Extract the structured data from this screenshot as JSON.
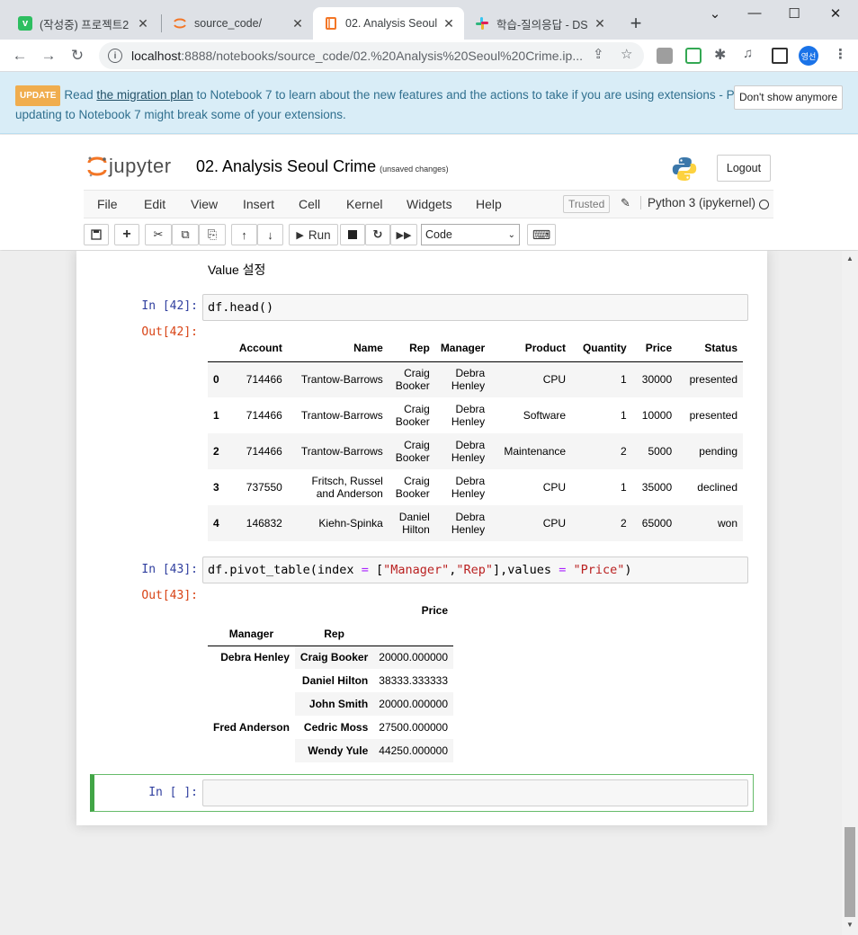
{
  "browser": {
    "tabs": [
      {
        "title": "(작성중) 프로젝트2",
        "favicon": "v",
        "favicon_color": "#2dbe60"
      },
      {
        "title": "source_code/",
        "favicon": "jupyter",
        "favicon_color": "#f37626"
      },
      {
        "title": "02. Analysis Seoul",
        "favicon": "notebook",
        "favicon_color": "#f37626",
        "active": true
      },
      {
        "title": "학습-질의응답 - DS",
        "favicon": "slack",
        "favicon_color": "#e01e5a"
      }
    ],
    "new_tab": "+",
    "window_controls": {
      "minimize": "—",
      "maximize": "☐",
      "close": "✕",
      "tabsearch": "⌄"
    },
    "url_host": "localhost",
    "url_path": ":8888/notebooks/source_code/02.%20Analysis%20Seoul%20Crime.ip...",
    "profile_label": "영선"
  },
  "banner": {
    "badge": "UPDATE",
    "text_before": "Read ",
    "link": "the migration plan",
    "text_after": " to Notebook 7 to learn about the new features and the actions to take if you are using extensions - Please note that updating to Notebook 7 might break some of your extensions.",
    "dismiss": "Don't show anymore"
  },
  "header": {
    "logo_text": "jupyter",
    "notebook_name": "02. Analysis Seoul Crime",
    "unsaved": "(unsaved changes)",
    "logout": "Logout"
  },
  "menu": {
    "items": [
      "File",
      "Edit",
      "View",
      "Insert",
      "Cell",
      "Kernel",
      "Widgets",
      "Help"
    ],
    "trusted": "Trusted",
    "kernel": "Python 3 (ipykernel)"
  },
  "toolbar": {
    "run": "Run",
    "cell_type": "Code"
  },
  "notebook": {
    "markdown_text": "Value 설정",
    "cell42": {
      "in_prompt": "In [42]:",
      "out_prompt": "Out[42]:",
      "code": "df.head()",
      "columns": [
        "",
        "Account",
        "Name",
        "Rep",
        "Manager",
        "Product",
        "Quantity",
        "Price",
        "Status"
      ],
      "rows": [
        {
          "idx": "0",
          "account": "714466",
          "name": "Trantow-Barrows",
          "rep": "Craig Booker",
          "manager": "Debra Henley",
          "product": "CPU",
          "quantity": "1",
          "price": "30000",
          "status": "presented"
        },
        {
          "idx": "1",
          "account": "714466",
          "name": "Trantow-Barrows",
          "rep": "Craig Booker",
          "manager": "Debra Henley",
          "product": "Software",
          "quantity": "1",
          "price": "10000",
          "status": "presented"
        },
        {
          "idx": "2",
          "account": "714466",
          "name": "Trantow-Barrows",
          "rep": "Craig Booker",
          "manager": "Debra Henley",
          "product": "Maintenance",
          "quantity": "2",
          "price": "5000",
          "status": "pending"
        },
        {
          "idx": "3",
          "account": "737550",
          "name": "Fritsch, Russel and Anderson",
          "rep": "Craig Booker",
          "manager": "Debra Henley",
          "product": "CPU",
          "quantity": "1",
          "price": "35000",
          "status": "declined"
        },
        {
          "idx": "4",
          "account": "146832",
          "name": "Kiehn-Spinka",
          "rep": "Daniel Hilton",
          "manager": "Debra Henley",
          "product": "CPU",
          "quantity": "2",
          "price": "65000",
          "status": "won"
        }
      ]
    },
    "cell43": {
      "in_prompt": "In [43]:",
      "out_prompt": "Out[43]:",
      "code_parts": [
        "df.pivot_table(index ",
        "=",
        " [",
        "\"Manager\"",
        ",",
        "\"Rep\"",
        "],values ",
        "=",
        " ",
        "\"Price\"",
        ")"
      ],
      "value_header": "Price",
      "index_names": [
        "Manager",
        "Rep"
      ],
      "rows": [
        {
          "manager": "Debra Henley",
          "rep": "Craig Booker",
          "price": "20000.000000"
        },
        {
          "manager": "",
          "rep": "Daniel Hilton",
          "price": "38333.333333"
        },
        {
          "manager": "",
          "rep": "John Smith",
          "price": "20000.000000"
        },
        {
          "manager": "Fred Anderson",
          "rep": "Cedric Moss",
          "price": "27500.000000"
        },
        {
          "manager": "",
          "rep": "Wendy Yule",
          "price": "44250.000000"
        }
      ]
    },
    "empty_cell": {
      "in_prompt": "In [ ]:"
    }
  }
}
